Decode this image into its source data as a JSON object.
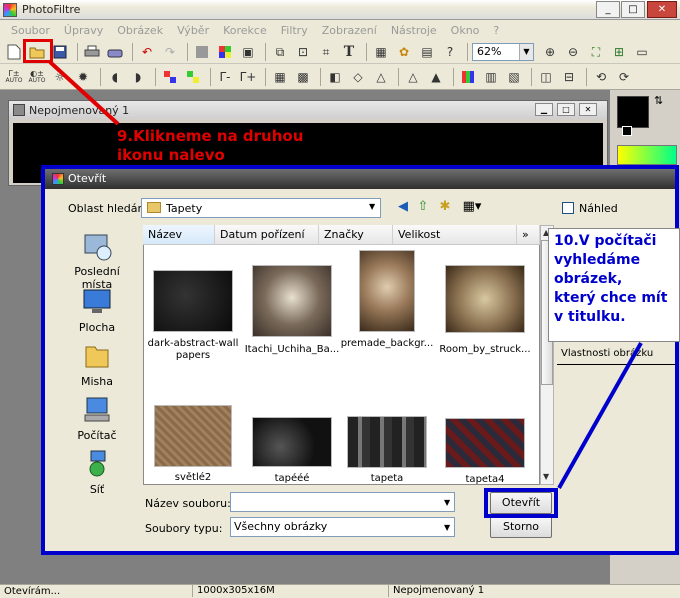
{
  "app": {
    "title": "PhotoFiltre",
    "window_controls": {
      "minimize": "_",
      "maximize": "□",
      "close": "✕"
    }
  },
  "menu": [
    "Soubor",
    "Úpravy",
    "Obrázek",
    "Výběr",
    "Korekce",
    "Filtry",
    "Zobrazení",
    "Nástroje",
    "Okno",
    "?"
  ],
  "toolbar": {
    "zoom": "62%",
    "text_tool": "T",
    "auto_label": "AUTO"
  },
  "document": {
    "title": "Nepojmenovaný 1"
  },
  "open_dialog": {
    "title": "Otevřít",
    "look_in_label": "Oblast hledání:",
    "look_in_value": "Tapety",
    "preview_label": "Náhled",
    "places": [
      {
        "label": "Poslední místa",
        "icon": "recent-places-icon"
      },
      {
        "label": "Plocha",
        "icon": "desktop-icon"
      },
      {
        "label": "Misha",
        "icon": "user-folder-icon"
      },
      {
        "label": "Počítač",
        "icon": "computer-icon"
      },
      {
        "label": "Síť",
        "icon": "network-icon"
      }
    ],
    "columns": [
      "Název",
      "Datum pořízení",
      "Značky",
      "Velikost",
      "»"
    ],
    "files": [
      {
        "name": "dark-abstract-wallpapers",
        "name_line1": "dark-abstract-wall",
        "name_line2": "papers"
      },
      {
        "name": "Itachi_Uchiha_Ba..."
      },
      {
        "name": "premade_backgr..."
      },
      {
        "name": "Room_by_struck..."
      },
      {
        "name": "světlé2"
      },
      {
        "name": "tapééé"
      },
      {
        "name": "tapeta"
      },
      {
        "name": "tapeta4"
      }
    ],
    "filename_label": "Název souboru:",
    "filename_value": "",
    "filetype_label": "Soubory typu:",
    "filetype_value": "Všechny obrázky",
    "open_button": "Otevřít",
    "cancel_button": "Storno",
    "properties_label": "Vlastnosti obrázku"
  },
  "annotations": {
    "step9_line1": "9.Klikneme na druhou",
    "step9_line2": "ikonu nalevo",
    "step10_lines": [
      "10.V počítači",
      "vyhledáme",
      "obrázek,",
      "který chce mít",
      "v titulku."
    ],
    "red_color": "#e00000",
    "blue_color": "#0000cc"
  },
  "status": {
    "left": "Otevírám...",
    "size": "1000x305x16M",
    "name": "Nepojmenovaný 1"
  }
}
